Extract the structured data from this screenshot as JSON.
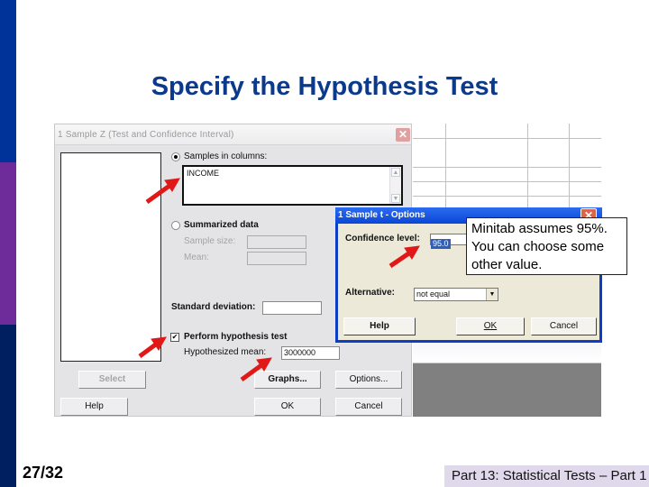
{
  "slide": {
    "title": "Specify the Hypothesis Test",
    "page_number": "27/32",
    "footer": "Part 13: Statistical Tests – Part 1",
    "callout": "Minitab assumes 95%. You can choose some other value.",
    "colors": {
      "title": "#0b3a8c",
      "stripe_top": "#003399",
      "stripe_mid": "#6e2c9a",
      "stripe_bottom": "#001f60",
      "arrow": "#e01818"
    }
  },
  "dialog_main": {
    "title": "1 Sample Z (Test and Confidence Interval)",
    "close_icon": "close-icon",
    "samples_in_columns": {
      "label": "Samples in columns:",
      "value": "INCOME",
      "selected": true
    },
    "summarized_data": {
      "label": "Summarized data",
      "selected": false
    },
    "sample_size": {
      "label": "Sample size:",
      "value": ""
    },
    "mean": {
      "label": "Mean:",
      "value": ""
    },
    "standard_deviation": {
      "label": "Standard deviation:",
      "value": ""
    },
    "perform_test": {
      "label": "Perform hypothesis test",
      "checked": true
    },
    "hypothesized_mean": {
      "label": "Hypothesized mean:",
      "value": "3000000"
    },
    "buttons": {
      "select": "Select",
      "graphs": "Graphs...",
      "options": "Options...",
      "help": "Help",
      "ok": "OK",
      "cancel": "Cancel"
    }
  },
  "dialog_options": {
    "title": "1 Sample t - Options",
    "confidence_level": {
      "label": "Confidence level:",
      "value": "95.0"
    },
    "alternative": {
      "label": "Alternative:",
      "value": "not equal"
    },
    "buttons": {
      "help": "Help",
      "ok": "OK",
      "cancel": "Cancel"
    }
  }
}
